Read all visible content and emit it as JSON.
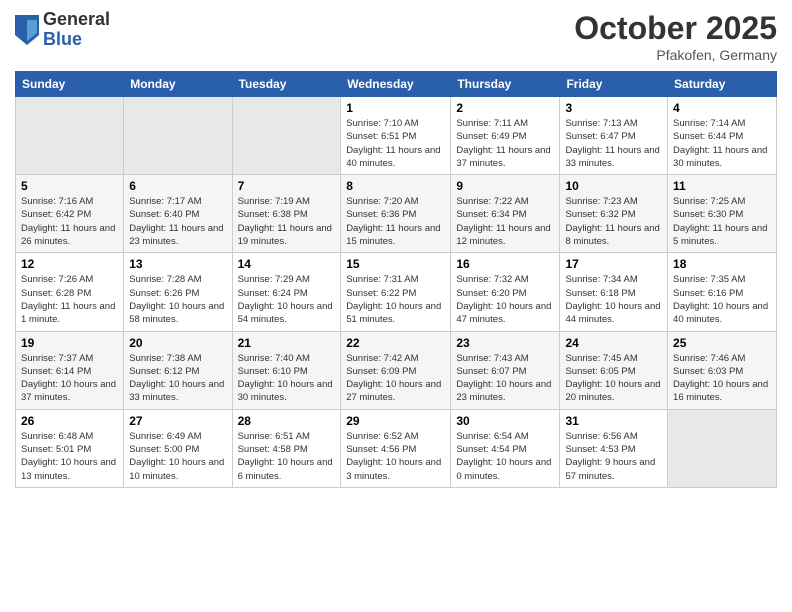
{
  "header": {
    "logo_general": "General",
    "logo_blue": "Blue",
    "month_title": "October 2025",
    "location": "Pfakofen, Germany"
  },
  "weekdays": [
    "Sunday",
    "Monday",
    "Tuesday",
    "Wednesday",
    "Thursday",
    "Friday",
    "Saturday"
  ],
  "weeks": [
    [
      {
        "day": "",
        "info": ""
      },
      {
        "day": "",
        "info": ""
      },
      {
        "day": "",
        "info": ""
      },
      {
        "day": "1",
        "info": "Sunrise: 7:10 AM\nSunset: 6:51 PM\nDaylight: 11 hours\nand 40 minutes."
      },
      {
        "day": "2",
        "info": "Sunrise: 7:11 AM\nSunset: 6:49 PM\nDaylight: 11 hours\nand 37 minutes."
      },
      {
        "day": "3",
        "info": "Sunrise: 7:13 AM\nSunset: 6:47 PM\nDaylight: 11 hours\nand 33 minutes."
      },
      {
        "day": "4",
        "info": "Sunrise: 7:14 AM\nSunset: 6:44 PM\nDaylight: 11 hours\nand 30 minutes."
      }
    ],
    [
      {
        "day": "5",
        "info": "Sunrise: 7:16 AM\nSunset: 6:42 PM\nDaylight: 11 hours\nand 26 minutes."
      },
      {
        "day": "6",
        "info": "Sunrise: 7:17 AM\nSunset: 6:40 PM\nDaylight: 11 hours\nand 23 minutes."
      },
      {
        "day": "7",
        "info": "Sunrise: 7:19 AM\nSunset: 6:38 PM\nDaylight: 11 hours\nand 19 minutes."
      },
      {
        "day": "8",
        "info": "Sunrise: 7:20 AM\nSunset: 6:36 PM\nDaylight: 11 hours\nand 15 minutes."
      },
      {
        "day": "9",
        "info": "Sunrise: 7:22 AM\nSunset: 6:34 PM\nDaylight: 11 hours\nand 12 minutes."
      },
      {
        "day": "10",
        "info": "Sunrise: 7:23 AM\nSunset: 6:32 PM\nDaylight: 11 hours\nand 8 minutes."
      },
      {
        "day": "11",
        "info": "Sunrise: 7:25 AM\nSunset: 6:30 PM\nDaylight: 11 hours\nand 5 minutes."
      }
    ],
    [
      {
        "day": "12",
        "info": "Sunrise: 7:26 AM\nSunset: 6:28 PM\nDaylight: 11 hours\nand 1 minute."
      },
      {
        "day": "13",
        "info": "Sunrise: 7:28 AM\nSunset: 6:26 PM\nDaylight: 10 hours\nand 58 minutes."
      },
      {
        "day": "14",
        "info": "Sunrise: 7:29 AM\nSunset: 6:24 PM\nDaylight: 10 hours\nand 54 minutes."
      },
      {
        "day": "15",
        "info": "Sunrise: 7:31 AM\nSunset: 6:22 PM\nDaylight: 10 hours\nand 51 minutes."
      },
      {
        "day": "16",
        "info": "Sunrise: 7:32 AM\nSunset: 6:20 PM\nDaylight: 10 hours\nand 47 minutes."
      },
      {
        "day": "17",
        "info": "Sunrise: 7:34 AM\nSunset: 6:18 PM\nDaylight: 10 hours\nand 44 minutes."
      },
      {
        "day": "18",
        "info": "Sunrise: 7:35 AM\nSunset: 6:16 PM\nDaylight: 10 hours\nand 40 minutes."
      }
    ],
    [
      {
        "day": "19",
        "info": "Sunrise: 7:37 AM\nSunset: 6:14 PM\nDaylight: 10 hours\nand 37 minutes."
      },
      {
        "day": "20",
        "info": "Sunrise: 7:38 AM\nSunset: 6:12 PM\nDaylight: 10 hours\nand 33 minutes."
      },
      {
        "day": "21",
        "info": "Sunrise: 7:40 AM\nSunset: 6:10 PM\nDaylight: 10 hours\nand 30 minutes."
      },
      {
        "day": "22",
        "info": "Sunrise: 7:42 AM\nSunset: 6:09 PM\nDaylight: 10 hours\nand 27 minutes."
      },
      {
        "day": "23",
        "info": "Sunrise: 7:43 AM\nSunset: 6:07 PM\nDaylight: 10 hours\nand 23 minutes."
      },
      {
        "day": "24",
        "info": "Sunrise: 7:45 AM\nSunset: 6:05 PM\nDaylight: 10 hours\nand 20 minutes."
      },
      {
        "day": "25",
        "info": "Sunrise: 7:46 AM\nSunset: 6:03 PM\nDaylight: 10 hours\nand 16 minutes."
      }
    ],
    [
      {
        "day": "26",
        "info": "Sunrise: 6:48 AM\nSunset: 5:01 PM\nDaylight: 10 hours\nand 13 minutes."
      },
      {
        "day": "27",
        "info": "Sunrise: 6:49 AM\nSunset: 5:00 PM\nDaylight: 10 hours\nand 10 minutes."
      },
      {
        "day": "28",
        "info": "Sunrise: 6:51 AM\nSunset: 4:58 PM\nDaylight: 10 hours\nand 6 minutes."
      },
      {
        "day": "29",
        "info": "Sunrise: 6:52 AM\nSunset: 4:56 PM\nDaylight: 10 hours\nand 3 minutes."
      },
      {
        "day": "30",
        "info": "Sunrise: 6:54 AM\nSunset: 4:54 PM\nDaylight: 10 hours\nand 0 minutes."
      },
      {
        "day": "31",
        "info": "Sunrise: 6:56 AM\nSunset: 4:53 PM\nDaylight: 9 hours\nand 57 minutes."
      },
      {
        "day": "",
        "info": ""
      }
    ]
  ]
}
